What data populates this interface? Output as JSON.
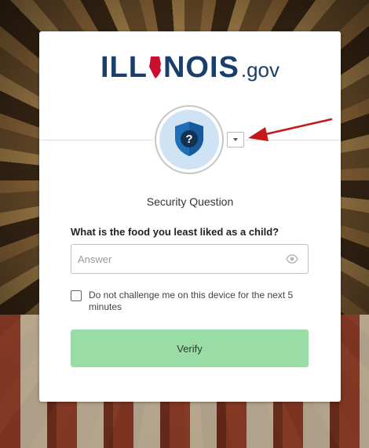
{
  "logo": {
    "text_left": "ILL",
    "text_right": "NOIS",
    "suffix": ".gov"
  },
  "factor": {
    "icon": "security-question-shield-icon",
    "dropdown_icon": "chevron-down-icon"
  },
  "form": {
    "title": "Security Question",
    "question": "What is the food you least liked as a child?",
    "answer_placeholder": "Answer",
    "answer_value": "",
    "show_password_icon": "eye-icon",
    "remember_label": "Do not challenge me on this device for the next 5 minutes",
    "remember_checked": false,
    "verify_label": "Verify"
  },
  "colors": {
    "brand_blue": "#1b3f6b",
    "verify_button": "#9adca6",
    "shield": "#1e6fb8",
    "annotation_arrow": "#c4191b"
  }
}
